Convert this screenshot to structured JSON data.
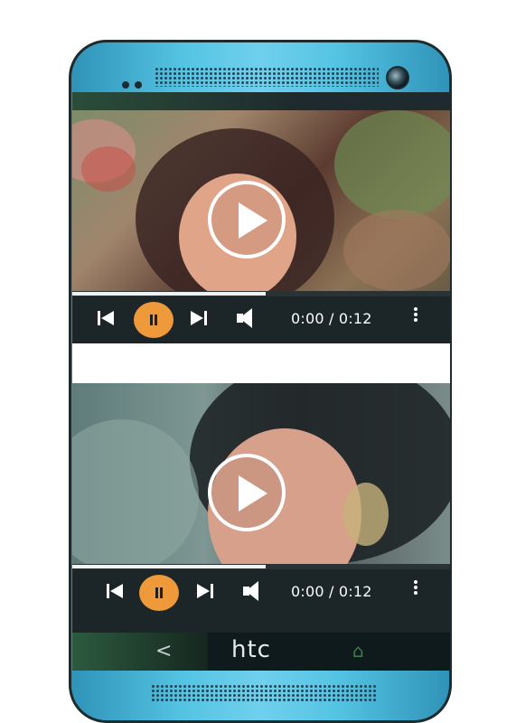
{
  "brand": "htc",
  "nav": {
    "back": "<",
    "home": "⌂"
  },
  "players": [
    {
      "time": "0:00 / 0:12",
      "progress": 0.51
    },
    {
      "time": "0:00 / 0:12",
      "progress": 0.51
    }
  ],
  "colors": {
    "accent": "#ef9a3a",
    "frame": "#55c4e3",
    "controls_bg": "#1c2528"
  },
  "icons": [
    "previous-icon",
    "pause-icon",
    "next-icon",
    "volume-icon",
    "more-vert-icon",
    "play-icon",
    "back-icon",
    "home-icon",
    "front-camera-icon"
  ]
}
